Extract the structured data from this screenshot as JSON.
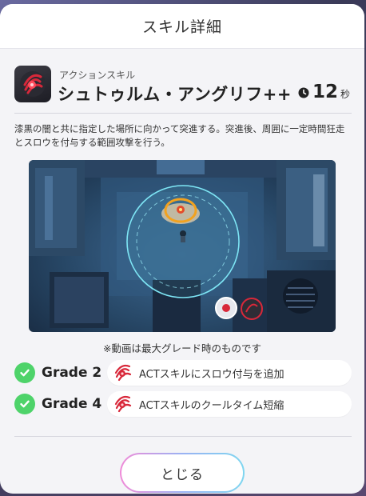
{
  "dialog": {
    "title": "スキル詳細"
  },
  "skill": {
    "type": "アクションスキル",
    "name": "シュトゥルム・アングリフ++",
    "cooldown_value": "12",
    "cooldown_unit": "秒",
    "icon": "drill-icon",
    "description": "漆黒の闇と共に指定した場所に向かって突進する。突進後、周囲に一定時間狂走とスロウを付与する範囲攻撃を行う。"
  },
  "video": {
    "note": "※動画は最大グレード時のものです"
  },
  "grades": [
    {
      "label": "Grade 2",
      "text": "ACTスキルにスロウ付与を追加",
      "unlocked": true
    },
    {
      "label": "Grade 4",
      "text": "ACTスキルのクールタイム短縮",
      "unlocked": true
    }
  ],
  "buttons": {
    "close_label": "とじる"
  },
  "colors": {
    "check_green": "#4ed36a",
    "icon_red": "#d8283a",
    "accent_gradient_start": "#f08bd8",
    "accent_gradient_end": "#7fd6f0"
  }
}
